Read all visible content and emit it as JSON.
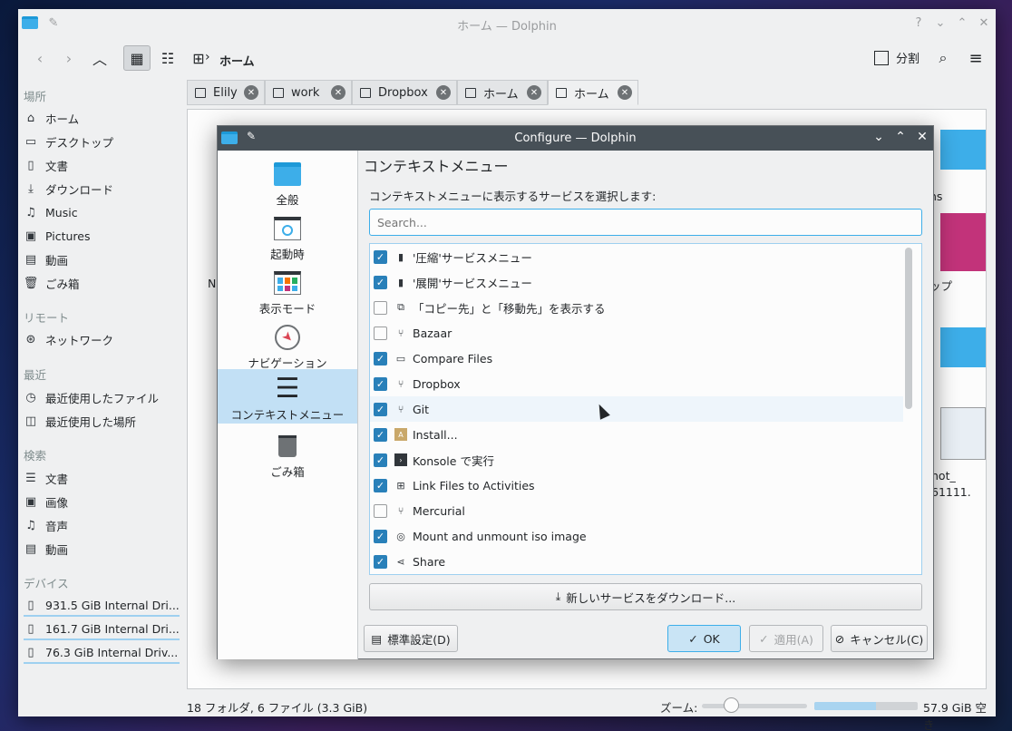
{
  "window": {
    "title": "ホーム — Dolphin"
  },
  "toolbar": {
    "breadcrumb": "ホーム",
    "split_label": "分割"
  },
  "places": {
    "sections": {
      "places": "場所",
      "remote": "リモート",
      "recent": "最近",
      "search": "検索",
      "devices": "デバイス"
    },
    "items": [
      {
        "label": "ホーム",
        "icon": "home-icon"
      },
      {
        "label": "デスクトップ",
        "icon": "desktop-icon"
      },
      {
        "label": "文書",
        "icon": "document-icon"
      },
      {
        "label": "ダウンロード",
        "icon": "download-icon"
      },
      {
        "label": "Music",
        "icon": "music-icon"
      },
      {
        "label": "Pictures",
        "icon": "picture-icon"
      },
      {
        "label": "動画",
        "icon": "video-icon"
      },
      {
        "label": "ごみ箱",
        "icon": "trash-icon"
      }
    ],
    "remote": [
      {
        "label": "ネットワーク",
        "icon": "network-icon"
      }
    ],
    "recent": [
      {
        "label": "最近使用したファイル",
        "icon": "recent-files-icon"
      },
      {
        "label": "最近使用した場所",
        "icon": "recent-places-icon"
      }
    ],
    "search": [
      {
        "label": "文書",
        "icon": "text-icon"
      },
      {
        "label": "画像",
        "icon": "image-icon"
      },
      {
        "label": "音声",
        "icon": "audio-icon"
      },
      {
        "label": "動画",
        "icon": "video-icon"
      }
    ],
    "devices": [
      {
        "label": "931.5 GiB Internal Dri...",
        "icon": "drive-icon"
      },
      {
        "label": "161.7 GiB Internal Dri...",
        "icon": "drive-icon"
      },
      {
        "label": "76.3 GiB Internal Driv...",
        "icon": "drive-icon"
      }
    ]
  },
  "tabs": [
    {
      "label": "Elily"
    },
    {
      "label": "work"
    },
    {
      "label": "Dropbox"
    },
    {
      "label": "ホーム"
    },
    {
      "label": "ホーム"
    }
  ],
  "view_fragments": {
    "a": "ns",
    "b": "ップ",
    "c": "N",
    "d": "hot_",
    "e": "61111."
  },
  "statusbar": {
    "info": "18 フォルダ, 6 ファイル (3.3 GiB)",
    "zoom_label": "ズーム:",
    "free": "57.9 GiB 空き"
  },
  "dialog": {
    "title": "Configure — Dolphin",
    "nav": [
      {
        "label": "全般"
      },
      {
        "label": "起動時"
      },
      {
        "label": "表示モード"
      },
      {
        "label": "ナビゲーション"
      },
      {
        "label": "コンテキストメニュー"
      },
      {
        "label": "ごみ箱"
      }
    ],
    "heading": "コンテキストメニュー",
    "description": "コンテキストメニューに表示するサービスを選択します:",
    "search_placeholder": "Search...",
    "services": [
      {
        "label": "'圧縮'サービスメニュー",
        "checked": true,
        "icon": "archive-icon"
      },
      {
        "label": "'展開'サービスメニュー",
        "checked": true,
        "icon": "archive-icon"
      },
      {
        "label": "「コピー先」と「移動先」を表示する",
        "checked": false,
        "icon": "copy-icon"
      },
      {
        "label": "Bazaar",
        "checked": false,
        "icon": "vcs-icon"
      },
      {
        "label": "Compare Files",
        "checked": true,
        "icon": "compare-icon"
      },
      {
        "label": "Dropbox",
        "checked": true,
        "icon": "vcs-icon"
      },
      {
        "label": "Git",
        "checked": true,
        "icon": "vcs-icon"
      },
      {
        "label": "Install...",
        "checked": true,
        "icon": "install-icon"
      },
      {
        "label": "Konsole で実行",
        "checked": true,
        "icon": "terminal-icon"
      },
      {
        "label": "Link Files to Activities",
        "checked": true,
        "icon": "activities-icon"
      },
      {
        "label": "Mercurial",
        "checked": false,
        "icon": "vcs-icon"
      },
      {
        "label": "Mount and unmount iso image",
        "checked": true,
        "icon": "disc-icon"
      },
      {
        "label": "Share",
        "checked": true,
        "icon": "share-icon"
      }
    ],
    "download_label": "新しいサービスをダウンロード...",
    "buttons": {
      "defaults": "標準設定(D)",
      "ok": "OK",
      "apply": "適用(A)",
      "cancel": "キャンセル(C)"
    }
  }
}
